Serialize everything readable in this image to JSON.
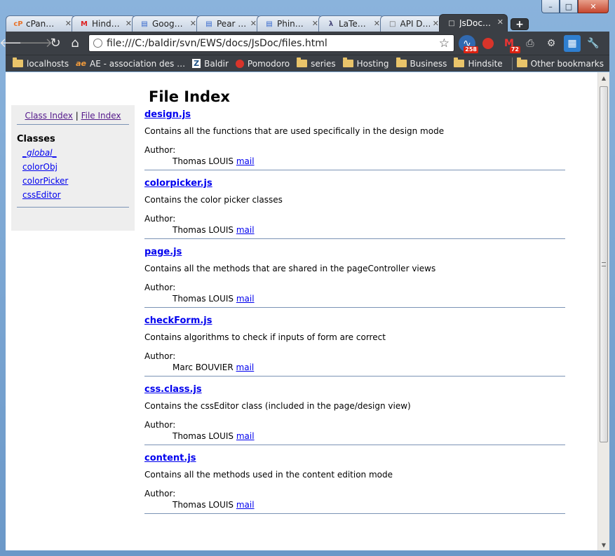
{
  "browser": {
    "tabs": [
      {
        "label": "cPan…",
        "icon": "cpanel-icon"
      },
      {
        "label": "Hind…",
        "icon": "gmail-icon"
      },
      {
        "label": "Goog…",
        "icon": "document-icon"
      },
      {
        "label": "Pear …",
        "icon": "document-icon"
      },
      {
        "label": "Phin…",
        "icon": "document-icon"
      },
      {
        "label": "LaTe…",
        "icon": "latex-icon"
      },
      {
        "label": "API D…",
        "icon": "page-icon"
      },
      {
        "label": "JsDoc…",
        "icon": "page-icon"
      }
    ],
    "url": "file:///C:/baldir/svn/EWS/docs/JsDoc/files.html",
    "extension_badges": {
      "rss": "258",
      "gmail": "72"
    },
    "bookmarks": [
      {
        "label": "localhosts",
        "icon": "folder-icon"
      },
      {
        "label": "AE - association des …",
        "icon": "ae-icon"
      },
      {
        "label": "Baldir",
        "icon": "z-icon"
      },
      {
        "label": "Pomodoro",
        "icon": "tomato-icon"
      },
      {
        "label": "series",
        "icon": "folder-icon"
      },
      {
        "label": "Hosting",
        "icon": "folder-icon"
      },
      {
        "label": "Business",
        "icon": "folder-icon"
      },
      {
        "label": "Hindsite",
        "icon": "folder-icon"
      }
    ],
    "other_bookmarks": "Other bookmarks"
  },
  "page": {
    "title": "File Index",
    "nav": {
      "class_index": "Class Index",
      "separator": "|",
      "file_index": "File Index"
    },
    "classes_heading": "Classes",
    "classes": [
      "_global_",
      "colorObj",
      "colorPicker",
      "cssEditor"
    ],
    "files": [
      {
        "name": "design.js",
        "description": "Contains all the functions that are used specifically in the design mode",
        "author_label": "Author:",
        "author": "Thomas LOUIS",
        "mail": "mail"
      },
      {
        "name": "colorpicker.js",
        "description": "Contains the color picker classes",
        "author_label": "Author:",
        "author": "Thomas LOUIS",
        "mail": "mail"
      },
      {
        "name": "page.js",
        "description": "Contains all the methods that are shared in the pageController views",
        "author_label": "Author:",
        "author": "Thomas LOUIS",
        "mail": "mail"
      },
      {
        "name": "checkForm.js",
        "description": "Contains algorithms to check if inputs of form are correct",
        "author_label": "Author:",
        "author": "Marc BOUVIER",
        "mail": "mail"
      },
      {
        "name": "css.class.js",
        "description": "Contains the cssEditor class (included in the page/design view)",
        "author_label": "Author:",
        "author": "Thomas LOUIS",
        "mail": "mail"
      },
      {
        "name": "content.js",
        "description": "Contains all the methods used in the content edition mode",
        "author_label": "Author:",
        "author": "Thomas LOUIS",
        "mail": "mail"
      }
    ]
  },
  "colors": {
    "link": "#0000ee",
    "visited": "#551a8b",
    "rule": "#7b93b5",
    "chrome_dark": "#3b3f45"
  }
}
